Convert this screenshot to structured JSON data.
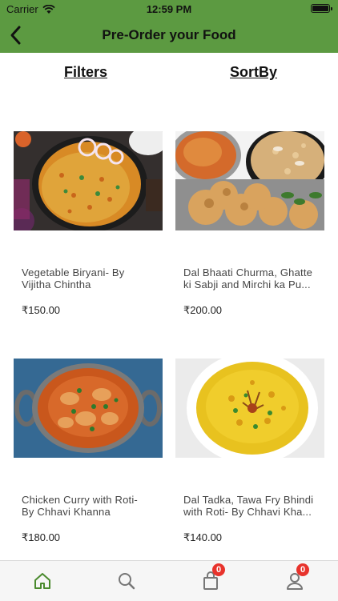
{
  "status_bar": {
    "carrier": "Carrier",
    "time": "12:59 PM"
  },
  "header": {
    "title": "Pre-Order your Food",
    "back_icon": "chevron-left-icon",
    "color": "#5c9a41"
  },
  "toolbar": {
    "filters_label": "Filters",
    "sortby_label": "SortBy"
  },
  "products": [
    {
      "name_line1": "Vegetable Biryani- By",
      "name_line2": "Vijitha Chintha",
      "price": "₹150.00"
    },
    {
      "name_line1": "Dal Bhaati Churma, Ghatte",
      "name_line2": "ki Sabji and Mirchi ka Pu...",
      "price": "₹200.00"
    },
    {
      "name_line1": "Chicken Curry with Roti-",
      "name_line2": "By Chhavi Khanna",
      "price": "₹180.00"
    },
    {
      "name_line1": "Dal Tadka, Tawa Fry Bhindi",
      "name_line2": "with Roti- By Chhavi Kha...",
      "price": "₹140.00"
    }
  ],
  "tab_bar": {
    "items": [
      "home-icon",
      "search-icon",
      "cart-icon",
      "profile-icon"
    ],
    "cart_badge": "0",
    "profile_badge": "0",
    "active_color": "#4a8a2e"
  }
}
